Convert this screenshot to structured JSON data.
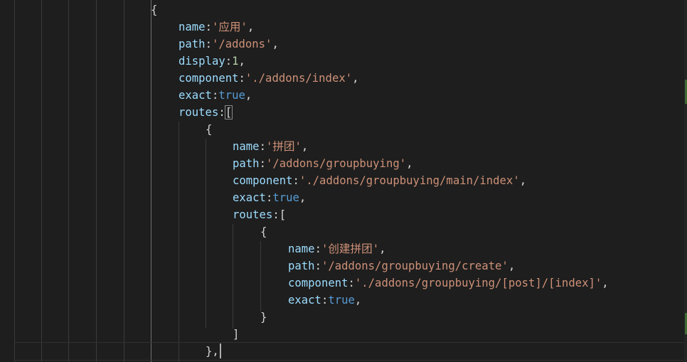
{
  "editor": {
    "lines": [
      {
        "id": "l1",
        "parts": [
          {
            "c": "p",
            "t": "{"
          }
        ]
      },
      {
        "id": "l2",
        "parts": [
          {
            "c": "k",
            "t": "name"
          },
          {
            "c": "p",
            "t": ":"
          },
          {
            "c": "s",
            "t": "'应用'"
          },
          {
            "c": "p",
            "t": ","
          }
        ]
      },
      {
        "id": "l3",
        "parts": [
          {
            "c": "k",
            "t": "path"
          },
          {
            "c": "p",
            "t": ":"
          },
          {
            "c": "s",
            "t": "'/addons'"
          },
          {
            "c": "p",
            "t": ","
          }
        ]
      },
      {
        "id": "l4",
        "parts": [
          {
            "c": "k",
            "t": "display"
          },
          {
            "c": "p",
            "t": ":"
          },
          {
            "c": "n",
            "t": "1"
          },
          {
            "c": "p",
            "t": ","
          }
        ]
      },
      {
        "id": "l5",
        "parts": [
          {
            "c": "k",
            "t": "component"
          },
          {
            "c": "p",
            "t": ":"
          },
          {
            "c": "s",
            "t": "'./addons/index'"
          },
          {
            "c": "p",
            "t": ","
          }
        ]
      },
      {
        "id": "l6",
        "parts": [
          {
            "c": "k",
            "t": "exact"
          },
          {
            "c": "p",
            "t": ":"
          },
          {
            "c": "b",
            "t": "true"
          },
          {
            "c": "p",
            "t": ","
          }
        ]
      },
      {
        "id": "l7",
        "parts": [
          {
            "c": "k",
            "t": "routes"
          },
          {
            "c": "p",
            "t": ":"
          },
          {
            "c": "p",
            "t": "["
          }
        ]
      },
      {
        "id": "l8",
        "parts": [
          {
            "c": "p",
            "t": "{"
          }
        ]
      },
      {
        "id": "l9",
        "parts": [
          {
            "c": "k",
            "t": "name"
          },
          {
            "c": "p",
            "t": ":"
          },
          {
            "c": "s",
            "t": "'拼团'"
          },
          {
            "c": "p",
            "t": ","
          }
        ]
      },
      {
        "id": "l10",
        "parts": [
          {
            "c": "k",
            "t": "path"
          },
          {
            "c": "p",
            "t": ":"
          },
          {
            "c": "s",
            "t": "'/addons/groupbuying'"
          },
          {
            "c": "p",
            "t": ","
          }
        ]
      },
      {
        "id": "l11",
        "parts": [
          {
            "c": "k",
            "t": "component"
          },
          {
            "c": "p",
            "t": ":"
          },
          {
            "c": "s",
            "t": "'./addons/groupbuying/main/index'"
          },
          {
            "c": "p",
            "t": ","
          }
        ]
      },
      {
        "id": "l12",
        "parts": [
          {
            "c": "k",
            "t": "exact"
          },
          {
            "c": "p",
            "t": ":"
          },
          {
            "c": "b",
            "t": "true"
          },
          {
            "c": "p",
            "t": ","
          }
        ]
      },
      {
        "id": "l13",
        "parts": [
          {
            "c": "k",
            "t": "routes"
          },
          {
            "c": "p",
            "t": ":"
          },
          {
            "c": "p",
            "t": "["
          }
        ]
      },
      {
        "id": "l14",
        "parts": [
          {
            "c": "p",
            "t": "{"
          }
        ]
      },
      {
        "id": "l15",
        "parts": [
          {
            "c": "k",
            "t": "name"
          },
          {
            "c": "p",
            "t": ":"
          },
          {
            "c": "s",
            "t": "'创建拼团'"
          },
          {
            "c": "p",
            "t": ","
          }
        ]
      },
      {
        "id": "l16",
        "parts": [
          {
            "c": "k",
            "t": "path"
          },
          {
            "c": "p",
            "t": ":"
          },
          {
            "c": "s",
            "t": "'/addons/groupbuying/create'"
          },
          {
            "c": "p",
            "t": ","
          }
        ]
      },
      {
        "id": "l17",
        "parts": [
          {
            "c": "k",
            "t": "component"
          },
          {
            "c": "p",
            "t": ":"
          },
          {
            "c": "s",
            "t": "'./addons/groupbuying/[post]/[index]'"
          },
          {
            "c": "p",
            "t": ","
          }
        ]
      },
      {
        "id": "l18",
        "parts": [
          {
            "c": "k",
            "t": "exact"
          },
          {
            "c": "p",
            "t": ":"
          },
          {
            "c": "b",
            "t": "true"
          },
          {
            "c": "p",
            "t": ","
          }
        ]
      },
      {
        "id": "l19",
        "parts": [
          {
            "c": "p",
            "t": "}"
          }
        ]
      },
      {
        "id": "l20",
        "parts": [
          {
            "c": "p",
            "t": "]"
          }
        ]
      },
      {
        "id": "l21",
        "parts": [
          {
            "c": "p",
            "t": "},"
          }
        ]
      }
    ]
  },
  "colors": {
    "background": "#1e1e1e",
    "property": "#9cdcfe",
    "string": "#ce9178",
    "number": "#b5cea8",
    "keyword": "#569cd6",
    "punctuation": "#d4d4d4"
  }
}
